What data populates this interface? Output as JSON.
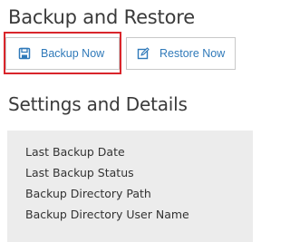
{
  "backup_section": {
    "title": "Backup and Restore",
    "backup_now_label": "Backup Now",
    "restore_now_label": "Restore Now",
    "backup_icon": "save-icon",
    "restore_icon": "edit-icon"
  },
  "settings_section": {
    "title": "Settings and Details",
    "rows": [
      {
        "label": "Last Backup Date"
      },
      {
        "label": "Last Backup Status"
      },
      {
        "label": "Backup Directory Path"
      },
      {
        "label": "Backup Directory User Name"
      }
    ]
  },
  "colors": {
    "accent": "#2f79b9",
    "highlight": "#d9252b",
    "panel_bg": "#ececec"
  }
}
